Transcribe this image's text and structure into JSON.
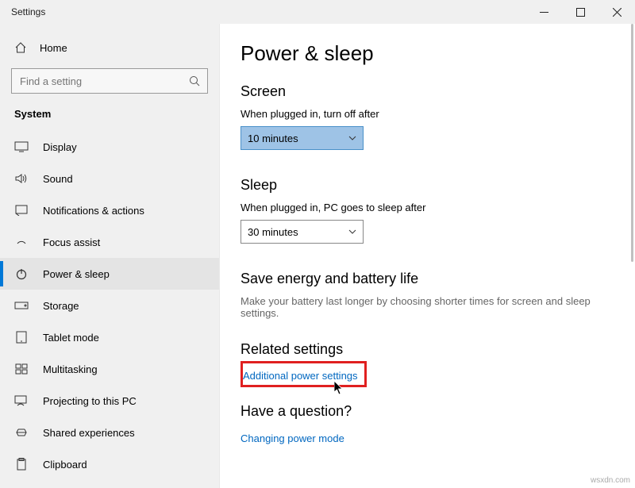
{
  "window": {
    "title": "Settings"
  },
  "sidebar": {
    "home_label": "Home",
    "search_placeholder": "Find a setting",
    "section_label": "System",
    "items": [
      {
        "label": "Display"
      },
      {
        "label": "Sound"
      },
      {
        "label": "Notifications & actions"
      },
      {
        "label": "Focus assist"
      },
      {
        "label": "Power & sleep"
      },
      {
        "label": "Storage"
      },
      {
        "label": "Tablet mode"
      },
      {
        "label": "Multitasking"
      },
      {
        "label": "Projecting to this PC"
      },
      {
        "label": "Shared experiences"
      },
      {
        "label": "Clipboard"
      }
    ]
  },
  "main": {
    "title": "Power & sleep",
    "screen": {
      "heading": "Screen",
      "label": "When plugged in, turn off after",
      "value": "10 minutes"
    },
    "sleep": {
      "heading": "Sleep",
      "label": "When plugged in, PC goes to sleep after",
      "value": "30 minutes"
    },
    "save": {
      "heading": "Save energy and battery life",
      "desc": "Make your battery last longer by choosing shorter times for screen and sleep settings."
    },
    "related": {
      "heading": "Related settings",
      "link": "Additional power settings"
    },
    "question": {
      "heading": "Have a question?",
      "link": "Changing power mode"
    }
  },
  "watermark": "wsxdn.com"
}
